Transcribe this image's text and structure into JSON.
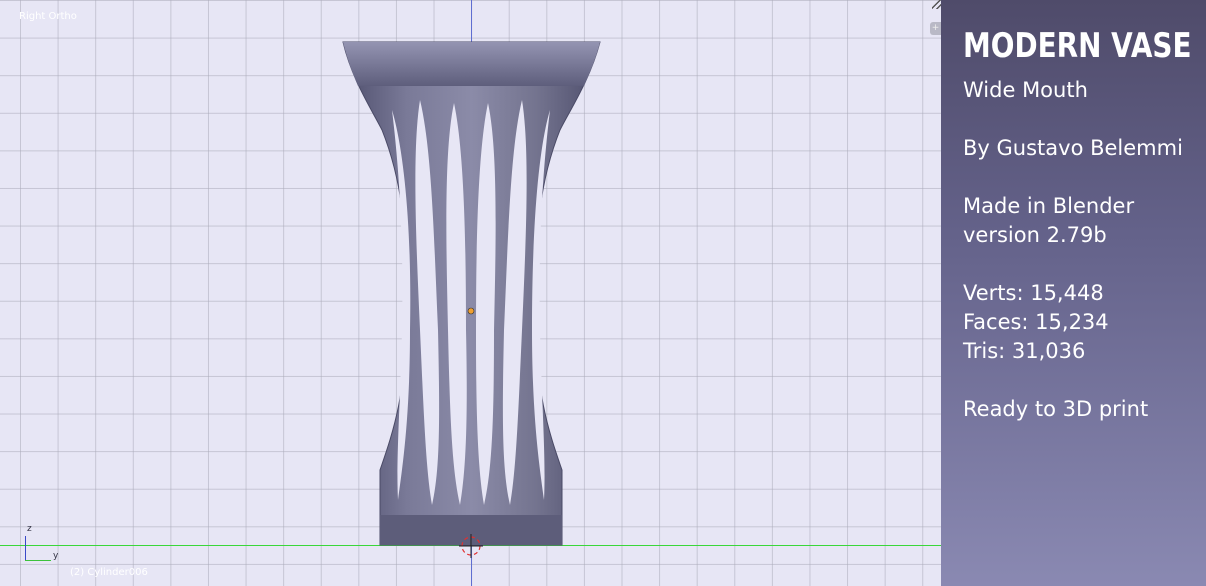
{
  "viewport": {
    "view_label": "Right Ortho",
    "object_label": "(2) Cylinder006",
    "gizmo": {
      "z_label": "z",
      "y_label": "y"
    },
    "colors": {
      "x_axis": "#39d739",
      "z_axis": "#5f6ed1",
      "vase": "#6c6c8c",
      "grid_bg": "#e7e6f5"
    }
  },
  "panel": {
    "title": "MODERN VASE",
    "subtitle": "Wide Mouth",
    "author": "By Gustavo Belemmi",
    "made_in": "Made in Blender",
    "version": "version 2.79b",
    "verts": "Verts: 15,448",
    "faces": "Faces: 15,234",
    "tris": "Tris: 31,036",
    "ready": "Ready to 3D print"
  }
}
